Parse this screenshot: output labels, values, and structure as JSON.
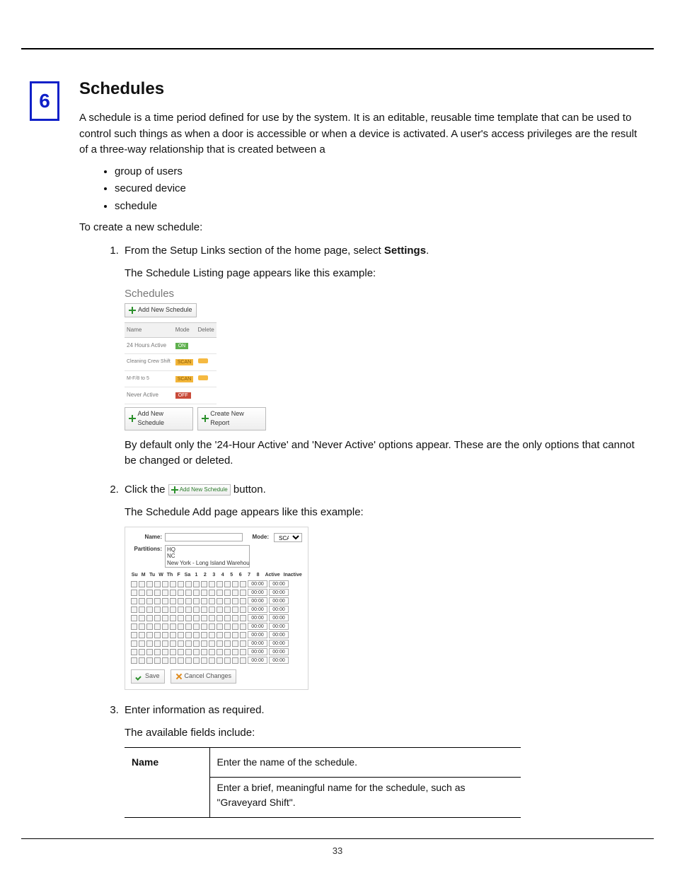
{
  "chapter_number": "6",
  "heading": "Schedules",
  "paragraphs": {
    "intro1": "A schedule is a time period defined for use by the system. It is an editable, reusable time template that can be used to control such things as when a door is accessible or when a device is activated. A user's access privileges are the result of a three-way relationship that is created between a",
    "bullet1": "group of users",
    "bullet2": "secured device",
    "bullet3": "schedule",
    "to_create": "To create a new schedule:"
  },
  "steps": {
    "s1_a": "From the Setup Links section of the home page, select ",
    "s1_bold": "Settings",
    "s1_end": ".",
    "s1_p": "The Schedule Listing page appears like this example:",
    "s1_after": "By default only the '24-Hour Active' and 'Never Active' options appear. These are the only options that cannot be changed or deleted.",
    "s2_a": "Click the ",
    "s2_b": " button.",
    "s2_p": "The Schedule Add page appears like this example:",
    "s3_a": "Enter information as required.",
    "s3_p": "The available fields include:"
  },
  "shot1": {
    "title": "Schedules",
    "add_btn": "Add New Schedule",
    "cols": {
      "name": "Name",
      "mode": "Mode",
      "delete": "Delete"
    },
    "rows": [
      {
        "name": "24 Hours Active",
        "mode": "ON",
        "mode_cls": "mode-on",
        "link": false,
        "deletable": false
      },
      {
        "name": "Cleaning Crew Shift",
        "mode": "SCAN",
        "mode_cls": "mode-scan",
        "link": true,
        "deletable": true
      },
      {
        "name": "M-F/8 to 5",
        "mode": "SCAN",
        "mode_cls": "mode-scan",
        "link": true,
        "deletable": true
      },
      {
        "name": "Never Active",
        "mode": "OFF",
        "mode_cls": "mode-off",
        "link": false,
        "deletable": false
      }
    ],
    "report_btn": "Create New Report"
  },
  "inline_btn": "Add New Schedule",
  "shot2": {
    "name_label": "Name:",
    "mode_label": "Mode:",
    "mode_value": "SCAN",
    "partitions_label": "Partitions:",
    "partitions": [
      "HQ",
      "NC",
      "New York - Long Island Warehouse"
    ],
    "day_headers": [
      "Su",
      "M",
      "Tu",
      "W",
      "Th",
      "F",
      "Sa",
      "1",
      "2",
      "3",
      "4",
      "5",
      "6",
      "7",
      "8"
    ],
    "col_active": "Active",
    "col_inactive": "Inactive",
    "time_default": "00:00",
    "row_count": 10,
    "save": "Save",
    "cancel": "Cancel Changes"
  },
  "field_table": {
    "name_label": "Name",
    "name_desc1": "Enter the name of the schedule.",
    "name_desc2": "Enter a brief, meaningful name for the schedule, such as \"Graveyard Shift\"."
  },
  "page_number": "33"
}
